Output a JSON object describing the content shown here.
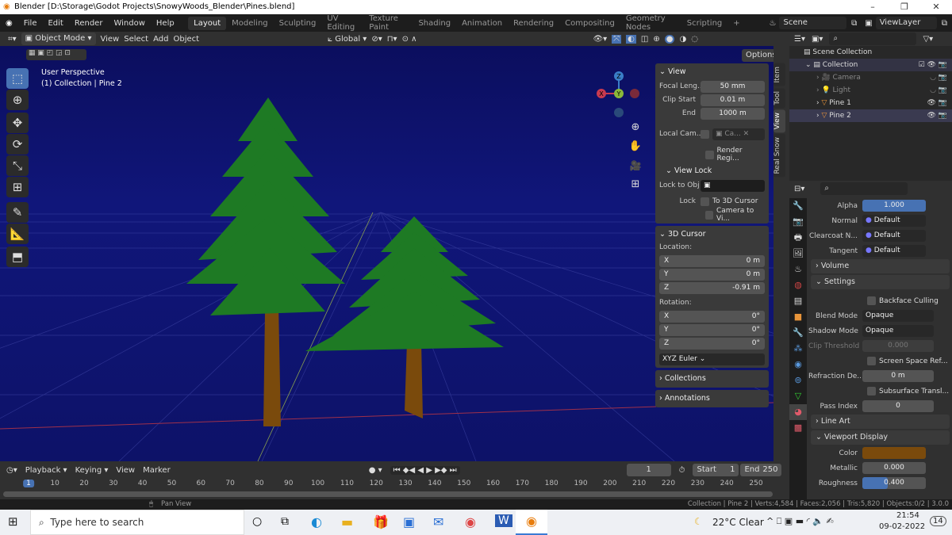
{
  "window": {
    "title": "Blender [D:\\Storage\\Godot Projects\\SnowyWoods_Blender\\Pines.blend]",
    "minimize": "–",
    "maximize": "❐",
    "close": "✕"
  },
  "menu": [
    "File",
    "Edit",
    "Render",
    "Window",
    "Help"
  ],
  "workspaces": [
    "Layout",
    "Modeling",
    "Sculpting",
    "UV Editing",
    "Texture Paint",
    "Shading",
    "Animation",
    "Rendering",
    "Compositing",
    "Geometry Nodes",
    "Scripting",
    "+"
  ],
  "scene": "Scene",
  "view_layer": "ViewLayer",
  "header": {
    "mode": "Object Mode",
    "items": [
      "View",
      "Select",
      "Add",
      "Object"
    ],
    "transform": "Global",
    "options": "Options"
  },
  "viewport": {
    "perspective": "User Perspective",
    "collection": "(1) Collection | Pine 2",
    "gizmo": {
      "x": "X",
      "y": "Y",
      "z": "Z"
    }
  },
  "npanel": {
    "view": {
      "title": "View",
      "focal_label": "Focal Leng...",
      "focal": "50 mm",
      "clip_start_label": "Clip Start",
      "clip_start": "0.01 m",
      "end_label": "End",
      "end": "1000 m",
      "local_cam_label": "Local Cam...",
      "local_cam": "Ca...",
      "render_region": "Render Regi..."
    },
    "view_lock": {
      "title": "View Lock",
      "lock_obj_label": "Lock to Obj",
      "lock_label": "Lock",
      "to_cursor": "To 3D Cursor",
      "camera_to_view": "Camera to Vi..."
    },
    "cursor": {
      "title": "3D Cursor",
      "location": "Location:",
      "x_label": "X",
      "x": "0 m",
      "y_label": "Y",
      "y": "0 m",
      "z_label": "Z",
      "z": "-0.91 m",
      "rotation": "Rotation:",
      "rx": "0°",
      "ry": "0°",
      "rz": "0°",
      "mode": "XYZ Euler"
    },
    "collections": "Collections",
    "annotations": "Annotations"
  },
  "tabs": [
    "Item",
    "Tool",
    "View",
    "Real Snow"
  ],
  "outliner": {
    "root": "Scene Collection",
    "items": [
      {
        "name": "Collection"
      },
      {
        "name": "Camera"
      },
      {
        "name": "Light"
      },
      {
        "name": "Pine 1"
      },
      {
        "name": "Pine 2"
      }
    ]
  },
  "properties": {
    "alpha_label": "Alpha",
    "alpha": "1.000",
    "normal_label": "Normal",
    "normal": "Default",
    "clearcoat_label": "Clearcoat N...",
    "clearcoat": "Default",
    "tangent_label": "Tangent",
    "tangent": "Default",
    "volume": "Volume",
    "settings": "Settings",
    "backface": "Backface Culling",
    "blend_label": "Blend Mode",
    "blend": "Opaque",
    "shadow_label": "Shadow Mode",
    "shadow": "Opaque",
    "clip_label": "Clip Threshold",
    "clip": "0.000",
    "ssr": "Screen Space Ref...",
    "refraction_label": "Refraction De...",
    "refraction": "0 m",
    "subsurface": "Subsurface Transl...",
    "pass_label": "Pass Index",
    "pass": "0",
    "line_art": "Line Art",
    "viewport_display": "Viewport Display",
    "color_label": "Color",
    "color": "#7a4a0c",
    "metallic_label": "Metallic",
    "metallic": "0.000",
    "roughness_label": "Roughness",
    "roughness": "0.400",
    "roughness_value": 0.4
  },
  "timeline": {
    "menus": [
      "Playback",
      "Keying",
      "View",
      "Marker"
    ],
    "current": "1",
    "start_label": "Start",
    "start": "1",
    "end_label": "End",
    "end": "250",
    "ticks": [
      "1",
      "10",
      "20",
      "30",
      "40",
      "50",
      "60",
      "70",
      "80",
      "90",
      "100",
      "110",
      "120",
      "130",
      "140",
      "150",
      "160",
      "170",
      "180",
      "190",
      "200",
      "210",
      "220",
      "230",
      "240",
      "250"
    ]
  },
  "status": {
    "pan": "Pan View",
    "info": "Collection | Pine 2 | Verts:4,584 | Faces:2,056 | Tris:5,820 | Objects:0/2 | 3.0.0"
  },
  "taskbar": {
    "search": "Type here to search",
    "weather": "22°C  Clear",
    "time": "21:54",
    "date": "09-02-2022",
    "notifications": "14"
  }
}
